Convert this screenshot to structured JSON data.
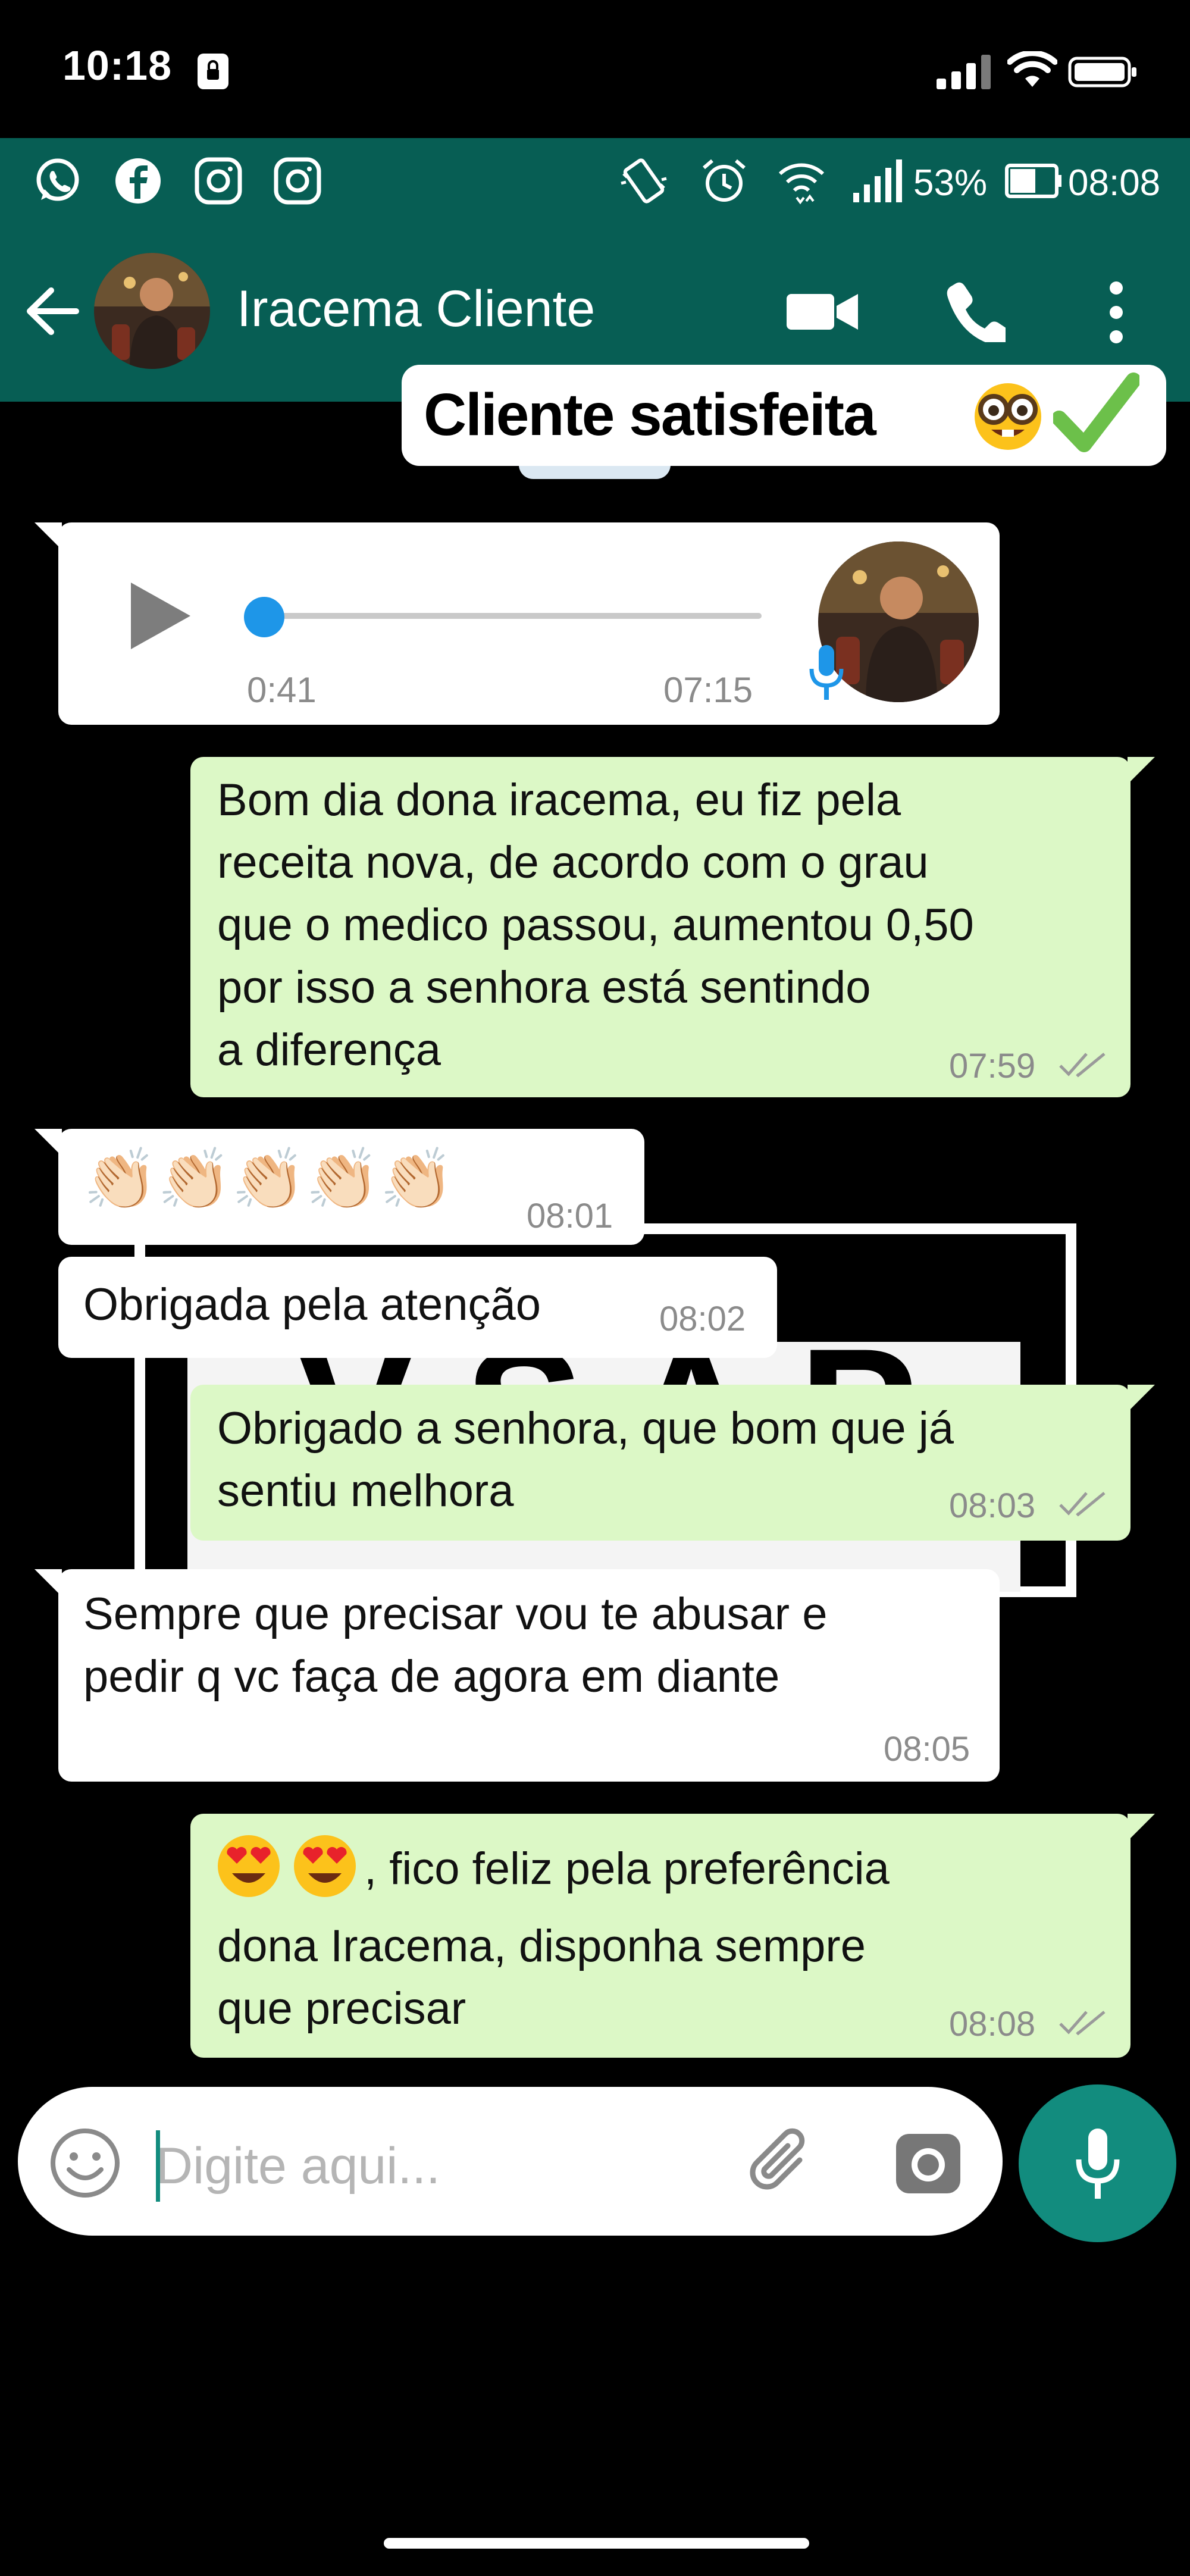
{
  "ios_status": {
    "time": "10:18"
  },
  "android_status": {
    "battery": "53%",
    "time": "08:08"
  },
  "header": {
    "contact_name": "Iracema Cliente"
  },
  "caption": {
    "text": "Cliente satisfeita"
  },
  "watermark": {
    "text": "V S A P"
  },
  "messages": [
    {
      "id": "voice",
      "direction": "in",
      "type": "voice",
      "duration": "0:41",
      "time": "07:15"
    },
    {
      "id": "m1",
      "direction": "out",
      "lines": [
        "Bom dia dona iracema, eu fiz pela",
        "receita nova, de acordo com o grau",
        "que o medico passou, aumentou 0,50",
        "por isso a senhora está sentindo",
        "a diferença"
      ],
      "time": "07:59"
    },
    {
      "id": "m2",
      "direction": "in",
      "text": "👏🏻👏🏻👏🏻👏🏻👏🏻",
      "time": "08:01"
    },
    {
      "id": "m3",
      "direction": "in",
      "lines": [
        "Obrigada pela atenção"
      ],
      "time": "08:02"
    },
    {
      "id": "m4",
      "direction": "out",
      "lines": [
        "Obrigado a senhora, que bom que já",
        "sentiu melhora"
      ],
      "time": "08:03"
    },
    {
      "id": "m5",
      "direction": "in",
      "lines": [
        "Sempre que precisar vou te abusar e",
        "pedir q vc faça de agora em diante"
      ],
      "time": "08:05"
    },
    {
      "id": "m6",
      "direction": "out",
      "lines": [
        ", fico feliz pela preferência",
        "dona Iracema, disponha sempre",
        "que precisar"
      ],
      "time": "08:08"
    }
  ],
  "composer": {
    "placeholder": "Digite aqui..."
  },
  "colors": {
    "header": "#075e54",
    "outgoing": "#dcf8c6",
    "incoming": "#ffffff",
    "accent": "#128c7e",
    "voice_dot": "#1e96e8"
  },
  "icons": [
    "whatsapp-icon",
    "facebook-icon",
    "instagram-icon",
    "vibrate-icon",
    "alarm-icon",
    "wifi-icon",
    "signal-icon",
    "battery-icon",
    "back-arrow-icon",
    "video-call-icon",
    "voice-call-icon",
    "more-options-icon",
    "play-icon",
    "mic-icon",
    "emoji-icon",
    "attach-icon",
    "camera-icon",
    "nerd-face-icon",
    "check-mark-icon",
    "heart-eyes-icon",
    "read-ticks-icon",
    "clapping-hands-icon"
  ]
}
